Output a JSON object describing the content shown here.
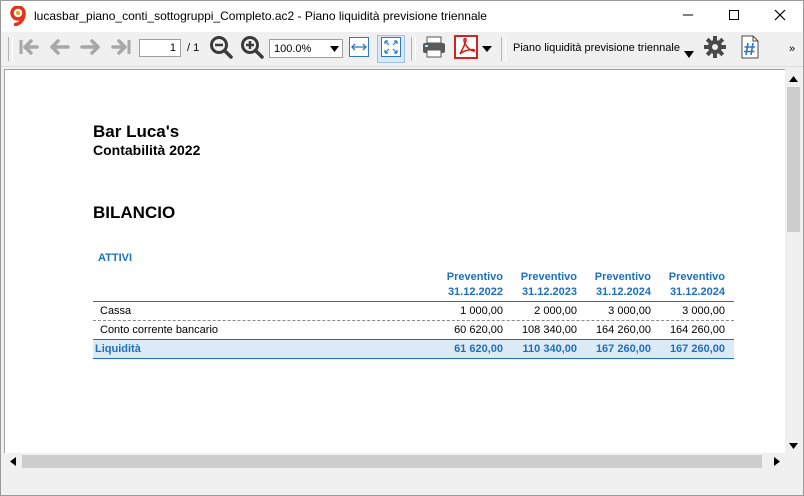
{
  "window": {
    "title": "lucasbar_piano_conti_sottogruppi_Completo.ac2 - Piano liquidità previsione triennale"
  },
  "toolbar": {
    "page_current": "1",
    "page_total": "/ 1",
    "zoom": "100.0%",
    "report_name": "Piano liquidità previsione triennale",
    "more": "»"
  },
  "report": {
    "company": "Bar Luca's",
    "subtitle": "Contabilità 2022",
    "section": "BILANCIO",
    "group": "ATTIVI",
    "columns": [
      {
        "line1": "Preventivo",
        "line2": "31.12.2022"
      },
      {
        "line1": "Preventivo",
        "line2": "31.12.2023"
      },
      {
        "line1": "Preventivo",
        "line2": "31.12.2024"
      },
      {
        "line1": "Preventivo",
        "line2": "31.12.2024"
      }
    ],
    "rows": [
      {
        "label": "Cassa",
        "values": [
          "1 000,00",
          "2 000,00",
          "3 000,00",
          "3 000,00"
        ]
      },
      {
        "label": "Conto corrente bancario",
        "values": [
          "60 620,00",
          "108 340,00",
          "164 260,00",
          "164 260,00"
        ]
      }
    ],
    "total": {
      "label": "Liquidità",
      "values": [
        "61 620,00",
        "110 340,00",
        "167 260,00",
        "167 260,00"
      ]
    }
  },
  "colors": {
    "accent": "#1e6fbe",
    "total_row_bg": "#dbeaf5"
  }
}
